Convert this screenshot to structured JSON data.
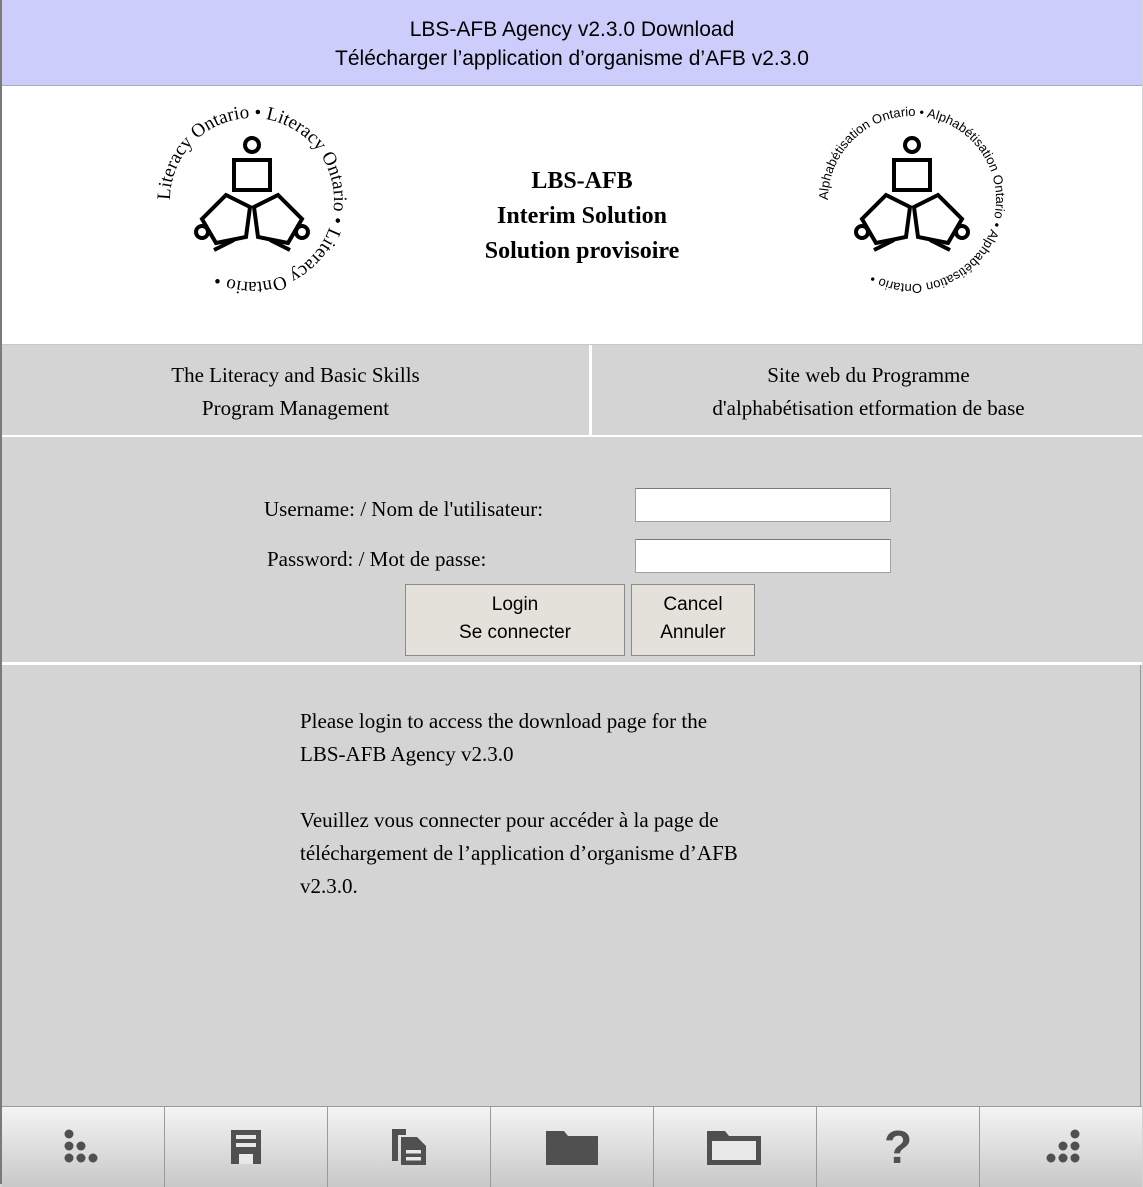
{
  "window": {
    "title_line1": "LBS-AFB Agency v2.3.0 Download",
    "title_line2": "Télécharger l’application d’organisme d’AFB v2.3.0"
  },
  "header": {
    "heading_line1": "LBS-AFB",
    "heading_line2": "Interim Solution",
    "heading_line3": "Solution provisoire",
    "logo_left_text": "Literacy Ontario • Literacy Ontario • Literacy Ontario •",
    "logo_right_text": "Alphabétisation Ontario • Alphabétisation Ontario • Alphabétisation Ontario •"
  },
  "links": {
    "english_line1": "The Literacy and Basic Skills",
    "english_line2": "Program Management",
    "french_line1": "Site web du Programme",
    "french_line2": "d'alphabétisation etformation de base"
  },
  "login": {
    "username_label": "Username: / Nom de l'utilisateur:",
    "username_value": "",
    "password_label": "Password: / Mot de passe:",
    "password_value": "",
    "login_button_line1": "Login",
    "login_button_line2": "Se connecter",
    "cancel_button_line1": "Cancel",
    "cancel_button_line2": "Annuler"
  },
  "message": {
    "english_line1": "Please login to access the download page for the",
    "english_line2": "LBS-AFB Agency v2.3.0",
    "french_line1": "Veuillez vous connecter pour accéder à la page de",
    "french_line2": "téléchargement de l’application d’organisme d’AFB",
    "french_line3": "v2.3.0."
  },
  "toolbar": {
    "buttons": [
      "menu-dots-left-icon",
      "save-icon",
      "copy-document-icon",
      "folder-closed-icon",
      "folder-open-icon",
      "help-icon",
      "menu-dots-right-icon"
    ]
  },
  "colors": {
    "titlebar_bg": "#cdcdfb",
    "page_bg": "#d4d4d4",
    "icon_color": "#505050"
  }
}
